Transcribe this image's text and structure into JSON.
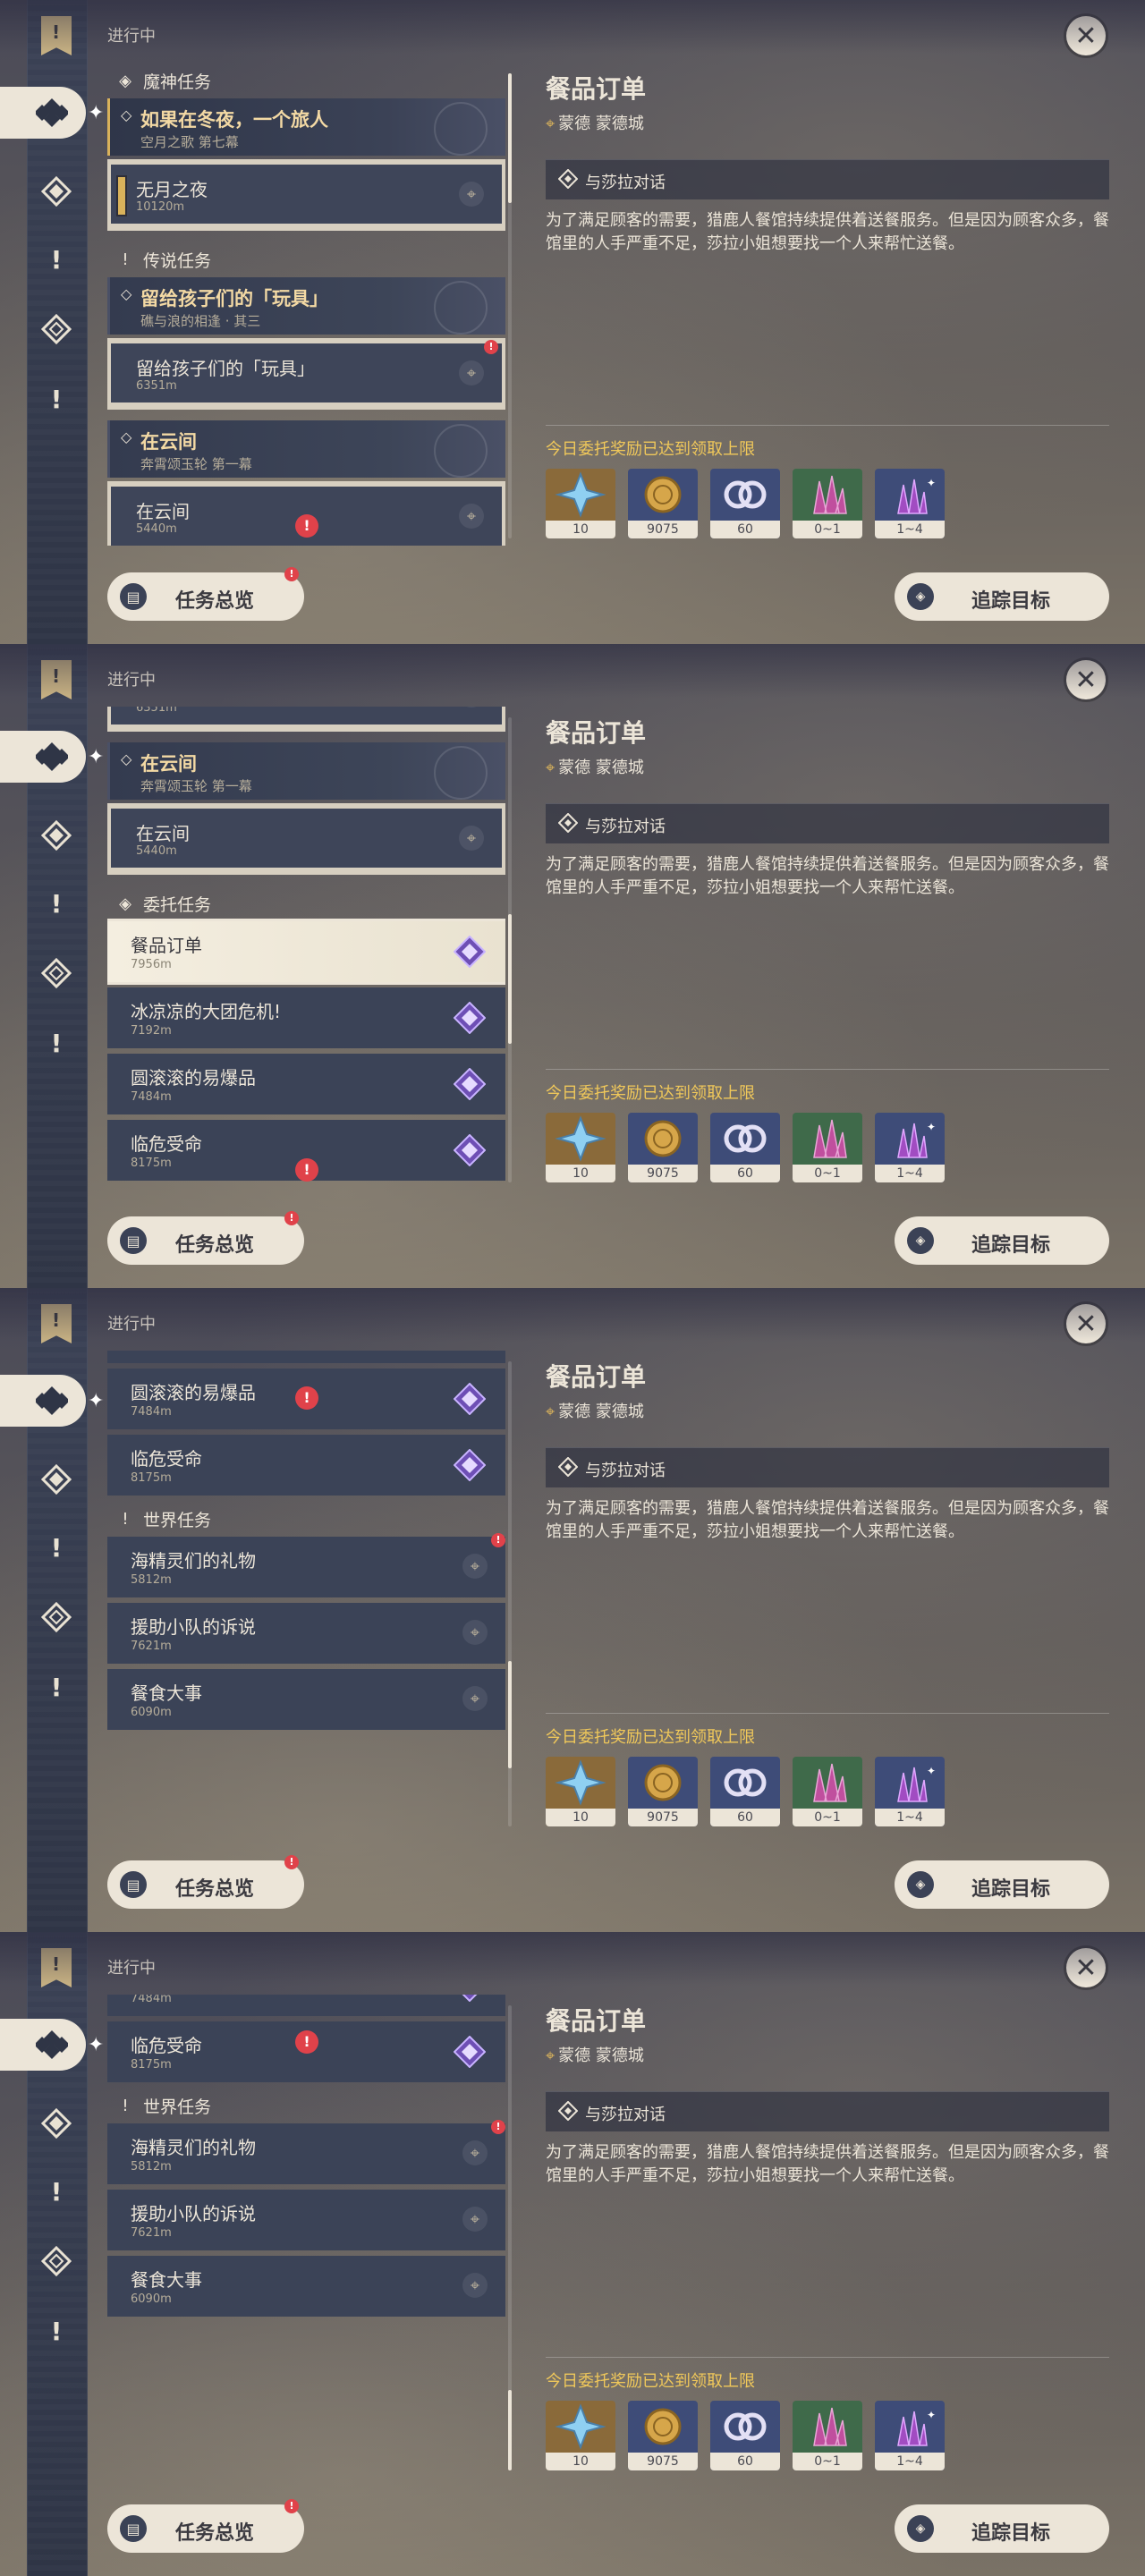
{
  "status_label": "进行中",
  "sections": {
    "archon": "魔神任务",
    "legend": "传说任务",
    "commission": "委托任务",
    "world": "世界任务"
  },
  "archon_quest": {
    "title": "如果在冬夜，一个旅人",
    "subtitle": "空月之歌 第七幕",
    "sub": {
      "title": "无月之夜",
      "distance": "10120m"
    }
  },
  "legend_quest_1": {
    "title": "留给孩子们的「玩具」",
    "subtitle": "礁与浪的相逢 · 其三",
    "sub": {
      "title": "留给孩子们的「玩具」",
      "distance": "6351m"
    }
  },
  "legend_quest_2": {
    "title": "在云间",
    "subtitle": "奔霄颂玉轮 第一幕",
    "sub": {
      "title": "在云间",
      "distance": "5440m"
    }
  },
  "commissions": [
    {
      "title": "餐品订单",
      "distance": "7956m"
    },
    {
      "title": "冰凉凉的大团危机!",
      "distance": "7192m"
    },
    {
      "title": "圆滚滚的易爆品",
      "distance": "7484m"
    },
    {
      "title": "临危受命",
      "distance": "8175m"
    }
  ],
  "world_quests": [
    {
      "title": "海精灵们的礼物",
      "distance": "5812m"
    },
    {
      "title": "援助小队的诉说",
      "distance": "7621m"
    },
    {
      "title": "餐食大事",
      "distance": "6090m"
    }
  ],
  "detail": {
    "title": "餐品订单",
    "location": "蒙德 蒙德城",
    "objective": "与莎拉对话",
    "description": "为了满足顾客的需要，猎鹿人餐馆持续提供着送餐服务。但是因为顾客众多，餐馆里的人手严重不足，莎拉小姐想要找一个人来帮忙送餐。",
    "reward_title": "今日委托奖励已达到领取上限",
    "rewards": [
      {
        "name": "primogem",
        "count": "10"
      },
      {
        "name": "mora",
        "count": "9075"
      },
      {
        "name": "friendship-exp",
        "count": "60"
      },
      {
        "name": "crystal-chunk",
        "count": "0~1"
      },
      {
        "name": "crystal-shard",
        "count": "1~4"
      }
    ]
  },
  "buttons": {
    "overview": "任务总览",
    "track": "追踪目标"
  },
  "colors": {
    "gold": "#d9b25b",
    "cream": "#ece5d8",
    "navy": "#3b4357",
    "reward_title": "#f0c85a",
    "alert": "#e0424a"
  }
}
